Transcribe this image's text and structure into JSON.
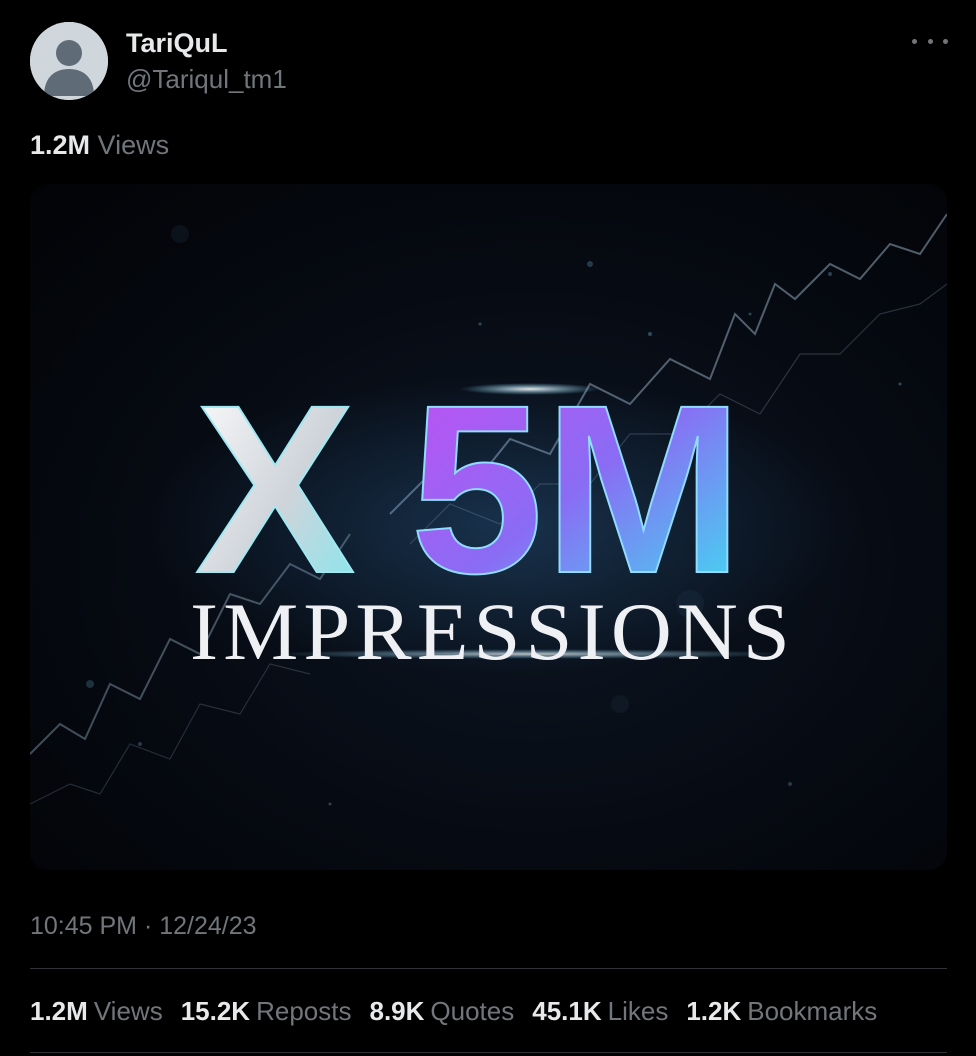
{
  "author": {
    "display_name": "TariQuL",
    "handle": "@Tariqul_tm1",
    "avatar_icon": "default-avatar-icon"
  },
  "more_icon": "more-horizontal-icon",
  "top_views": {
    "count": "1.2M",
    "label": "Views"
  },
  "media": {
    "headline_x": "X",
    "headline_5m": "5M",
    "subtitle": "IMPRESSIONS",
    "colors": {
      "silver": "#dfe3e8",
      "purple": "#b44cf0",
      "cyan": "#3ee6f2"
    }
  },
  "timestamp": "10:45 PM · 12/24/23",
  "stats": [
    {
      "count": "1.2M",
      "label": "Views"
    },
    {
      "count": "15.2K",
      "label": "Reposts"
    },
    {
      "count": "8.9K",
      "label": "Quotes"
    },
    {
      "count": "45.1K",
      "label": "Likes"
    },
    {
      "count": "1.2K",
      "label": "Bookmarks"
    }
  ]
}
